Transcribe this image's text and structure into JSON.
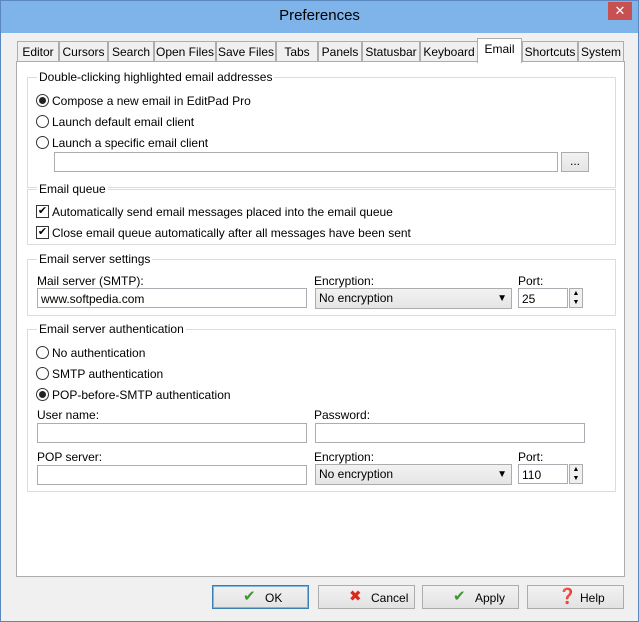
{
  "window": {
    "title": "Preferences",
    "close_glyph": "✕"
  },
  "tabs": [
    {
      "label": "Editor"
    },
    {
      "label": "Cursors"
    },
    {
      "label": "Search"
    },
    {
      "label": "Open Files"
    },
    {
      "label": "Save Files"
    },
    {
      "label": "Tabs"
    },
    {
      "label": "Panels"
    },
    {
      "label": "Statusbar"
    },
    {
      "label": "Keyboard"
    },
    {
      "label": "Email"
    },
    {
      "label": "Shortcuts"
    },
    {
      "label": "System"
    }
  ],
  "active_tab": "Email",
  "double_click": {
    "legend": "Double-clicking highlighted email addresses",
    "options": [
      {
        "label": "Compose a new email in EditPad Pro",
        "selected": true
      },
      {
        "label": "Launch default email client",
        "selected": false
      },
      {
        "label": "Launch a specific email client",
        "selected": false
      }
    ],
    "client_path": "",
    "browse_label": "..."
  },
  "email_queue": {
    "legend": "Email queue",
    "options": [
      {
        "label": "Automatically send email messages placed into the email queue",
        "checked": true
      },
      {
        "label": "Close email queue automatically after all messages have been sent",
        "checked": true
      }
    ]
  },
  "server_settings": {
    "legend": "Email server settings",
    "mail_server_label": "Mail server (SMTP):",
    "mail_server_value": "www.softpedia.com",
    "encryption_label": "Encryption:",
    "encryption_value": "No encryption",
    "port_label": "Port:",
    "port_value": "25"
  },
  "authentication": {
    "legend": "Email server authentication",
    "options": [
      {
        "label": "No authentication",
        "selected": false
      },
      {
        "label": "SMTP authentication",
        "selected": false
      },
      {
        "label": "POP-before-SMTP authentication",
        "selected": true
      }
    ],
    "username_label": "User name:",
    "username_value": "",
    "password_label": "Password:",
    "password_value": "",
    "pop_server_label": "POP server:",
    "pop_server_value": "",
    "encryption_label": "Encryption:",
    "encryption_value": "No encryption",
    "port_label": "Port:",
    "port_value": "110"
  },
  "buttons": {
    "ok": "OK",
    "cancel": "Cancel",
    "apply": "Apply",
    "help": "Help"
  },
  "colors": {
    "ok_icon": "#3a9a2a",
    "cancel_icon": "#d42b1e",
    "apply_icon": "#3a9a2a",
    "help_icon": "#2f6fcf"
  }
}
